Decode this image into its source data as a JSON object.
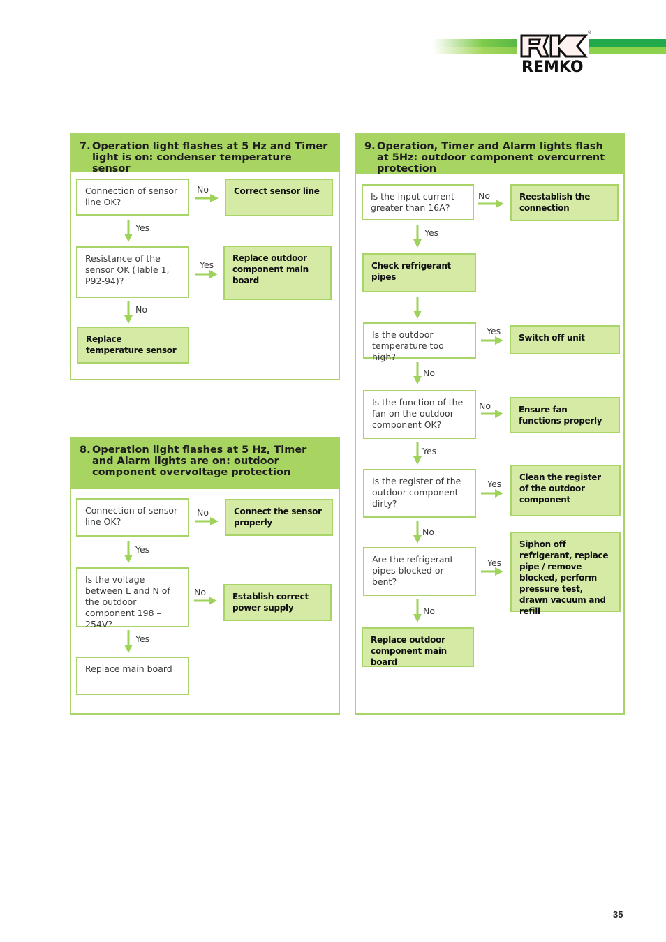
{
  "header": {
    "brand": "REMKO",
    "registered_mark": "®",
    "colors": {
      "green_dark": "#22a94b",
      "green_light": "#8cd24c",
      "panel_green": "#a8d462",
      "action_fill": "#d5eaa5"
    }
  },
  "panels": {
    "p7": {
      "number": "7.",
      "title": "Operation light flashes at 5 Hz and Timer light is on: condenser temperature sensor",
      "q1": "Connection of sensor line OK?",
      "q1_no_label": "No",
      "a1": "Correct sensor line",
      "q1_yes_label": "Yes",
      "q2": "Resistance of the sensor OK (Table 1, P92-94)?",
      "q2_yes_label": "Yes",
      "a2": "Replace outdoor component main board",
      "q2_no_label": "No",
      "a3": "Replace temperature sensor"
    },
    "p8": {
      "number": "8.",
      "title": "Operation light flashes at 5 Hz, Timer and Alarm lights are on: outdoor component overvoltage protection",
      "q1": "Connection of sensor line OK?",
      "q1_no_label": "No",
      "a1": "Connect the sensor properly",
      "q1_yes_label": "Yes",
      "q2": "Is the voltage between L and N of the outdoor component 198 – 254V?",
      "q2_no_label": "No",
      "a2": "Establish correct power supply",
      "q2_yes_label": "Yes",
      "a3": "Replace main board"
    },
    "p9": {
      "number": "9.",
      "title": "Operation, Timer and Alarm lights flash at 5Hz: outdoor component overcurrent protection",
      "q1": "Is the input current greater than 16A?",
      "q1_no_label": "No",
      "a1": "Reestablish the connection",
      "q1_yes_label": "Yes",
      "s1": "Check refrigerant pipes",
      "q2": "Is the outdoor temperature too high?",
      "q2_yes_label": "Yes",
      "a2": "Switch off unit",
      "q2_no_label": "No",
      "q3": "Is the function of the fan on the outdoor component OK?",
      "q3_no_label": "No",
      "a3": "Ensure fan functions properly",
      "q3_yes_label": "Yes",
      "q4": "Is the register of the outdoor component dirty?",
      "q4_yes_label": "Yes",
      "a4": "Clean the register of the outdoor component",
      "q4_no_label": "No",
      "q5": "Are the refrigerant pipes blocked or bent?",
      "q5_yes_label": "Yes",
      "a5": "Siphon off refrigerant, replace pipe / remove blocked, perform pressure test, drawn vacuum and refill",
      "q5_no_label": "No",
      "a6": "Replace outdoor component main board"
    }
  },
  "footer": {
    "page_number": "35"
  }
}
